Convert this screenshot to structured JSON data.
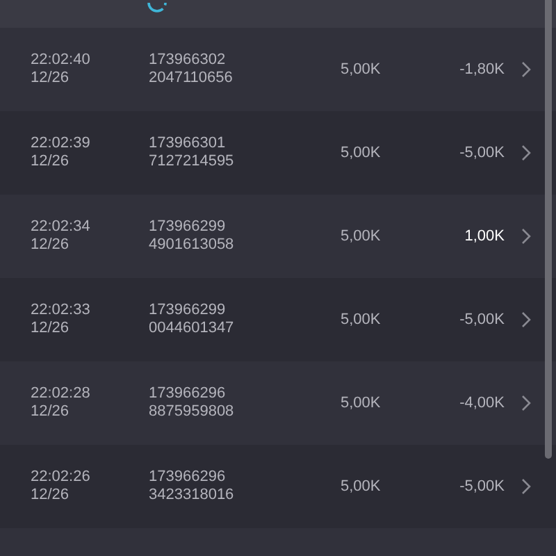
{
  "rows": [
    {
      "time": "22:02:40",
      "date": "12/26",
      "id_line1": "173966302",
      "id_line2": "2047110656",
      "amount": "5,00K",
      "result": "-1,80K",
      "positive": false
    },
    {
      "time": "22:02:39",
      "date": "12/26",
      "id_line1": "173966301",
      "id_line2": "7127214595",
      "amount": "5,00K",
      "result": "-5,00K",
      "positive": false
    },
    {
      "time": "22:02:34",
      "date": "12/26",
      "id_line1": "173966299",
      "id_line2": "4901613058",
      "amount": "5,00K",
      "result": "1,00K",
      "positive": true
    },
    {
      "time": "22:02:33",
      "date": "12/26",
      "id_line1": "173966299",
      "id_line2": "0044601347",
      "amount": "5,00K",
      "result": "-5,00K",
      "positive": false
    },
    {
      "time": "22:02:28",
      "date": "12/26",
      "id_line1": "173966296",
      "id_line2": "8875959808",
      "amount": "5,00K",
      "result": "-4,00K",
      "positive": false
    },
    {
      "time": "22:02:26",
      "date": "12/26",
      "id_line1": "173966296",
      "id_line2": "3423318016",
      "amount": "5,00K",
      "result": "-5,00K",
      "positive": false
    }
  ]
}
